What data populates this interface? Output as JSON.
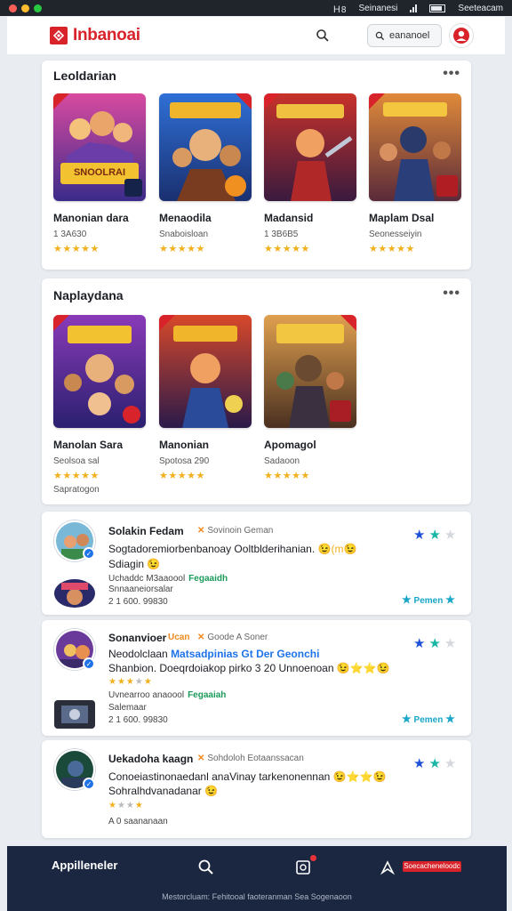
{
  "status_bar": {
    "left_text": "Ｈ8",
    "title": "Seinanesi",
    "signal": "1",
    "right_text": "Seeteacam"
  },
  "header": {
    "brand": "Inbanoai",
    "search_button_label": "eananoel"
  },
  "sections": [
    {
      "title": "Leoldarian",
      "games": [
        {
          "title": "Manonian dara",
          "subtitle": "1 3A630",
          "stars": "★★★★★"
        },
        {
          "title": "Menaodila",
          "subtitle": "Snaboisloan",
          "stars": "★★★★★"
        },
        {
          "title": "Madansid",
          "subtitle": "1 3B6B5",
          "stars": "★★★★★"
        },
        {
          "title": "Maplam Dsal",
          "subtitle": "Seonesseiyin",
          "stars": "★★★★★"
        }
      ]
    },
    {
      "title": "Naplaydana",
      "games": [
        {
          "title": "Manolan Sara",
          "subtitle": "Seolsoa sal",
          "stars": "★★★★★"
        },
        {
          "title": "Manonian",
          "subtitle": "Spotosa 290",
          "stars": "★★★★★"
        },
        {
          "title": "Apomagol",
          "subtitle": "Sadaoon",
          "stars": "★★★★★"
        }
      ],
      "extra_line": "Sapratogon"
    }
  ],
  "reviews": [
    {
      "name": "Solakin Fedam",
      "tag": "Sovinoin Geman",
      "text_line1": "Sogtadoremiorbenbanoay Ooltblderihanian.",
      "text_line1_emoji": "😉(m😉",
      "text_line2": "Sdiagin",
      "text_line2_emoji": "😉",
      "meta_line": "Uchaddc M3aaoool",
      "meta_link": "Fegaaidh",
      "sub_meta": "Snnaaneiorsalar",
      "date_line": "2 1 600. 99830",
      "reply_label": "Pemen"
    },
    {
      "name": "Sonanvioer",
      "badge": "Ucan",
      "tag": "Goode A Soner",
      "text_line1": "Neodolclaan",
      "text_line1_highlight": "Matsadpinias  Gt Der Geonchi",
      "text_line2": "Shanbion. Doeqrdoiakop pirko 3 20 Unnoenoan",
      "text_line2_emoji": "😉⭐⭐😉",
      "meta_line": "Uvnearroo anaoool",
      "meta_link": "Fegaaiah",
      "sub_meta": "Salemaar",
      "date_line": "2 1 600. 99830",
      "reply_label": "Pemen"
    },
    {
      "name": "Uekadoha kaagn",
      "tag": "Sohdoloh Eotaanssacan",
      "text_line1": "Conoeiastinonaedanl anaVinay tarkenonennan",
      "text_line1_emoji": "😉⭐⭐😉",
      "text_line2": "Sohralhdvanadanar",
      "text_line2_emoji": "😉",
      "date_line": "A 0 saananaan"
    }
  ],
  "bottom_nav": {
    "label": "Appilleneler",
    "badge_text": "Soecacheneloodc"
  },
  "footer_text": "Mestorcluam: Fehitooal faoteranman Sea Sogenaoon",
  "colors": {
    "brand_red": "#d8232a",
    "nav_bg": "#1b2740",
    "star_gold": "#f2b01e",
    "accent_blue": "#1e73e8"
  }
}
